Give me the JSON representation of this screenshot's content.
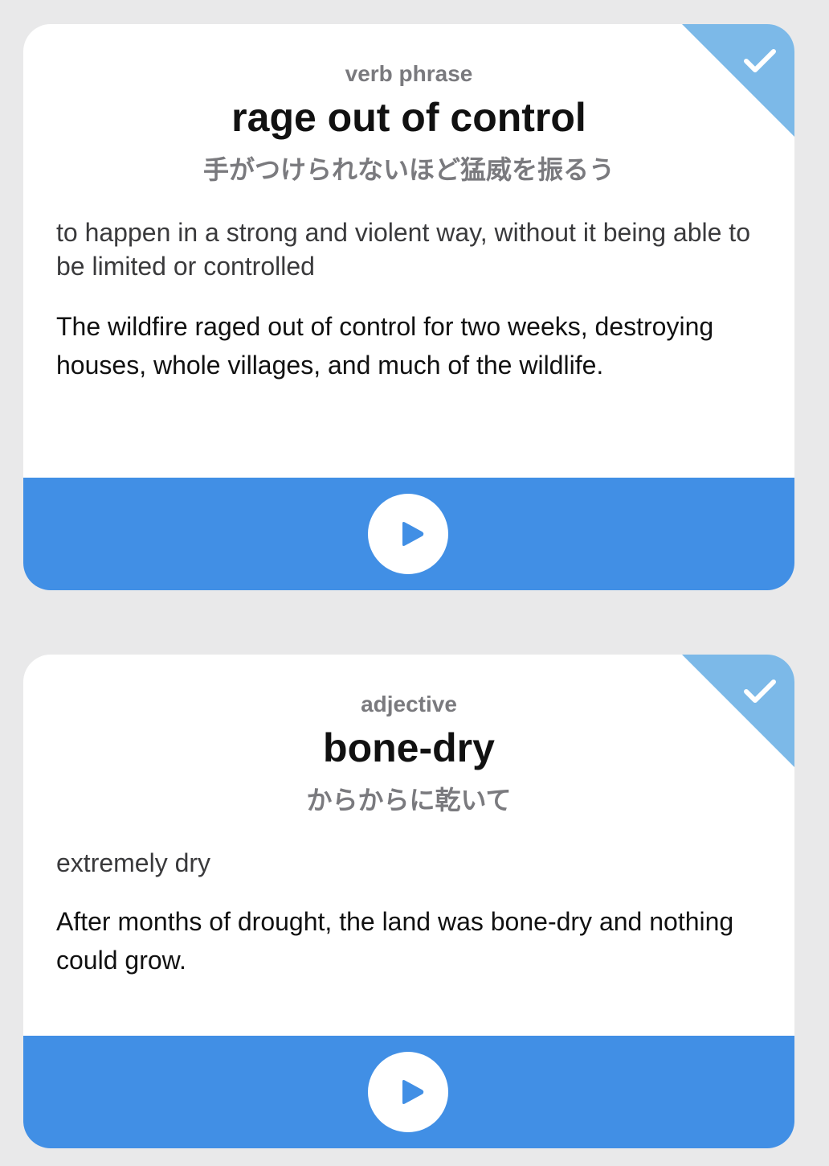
{
  "colors": {
    "background": "#e9e9ea",
    "card": "#ffffff",
    "accent_blue": "#418fe5",
    "corner_badge": "#7cb9e8"
  },
  "cards": [
    {
      "part_of_speech": "verb phrase",
      "word": "rage out of control",
      "translation": "手がつけられないほど猛威を振るう",
      "definition": "to happen in a strong and violent way, without it being able to be limited or controlled",
      "example": "The wildfire raged out of control for two weeks, destroying houses, whole villages, and much of the wildlife.",
      "checked_icon": "checkmark-icon",
      "audio_icon": "play-icon"
    },
    {
      "part_of_speech": "adjective",
      "word": "bone-dry",
      "translation": "からからに乾いて",
      "definition": "extremely dry",
      "example": "After months of drought, the land was bone-dry and nothing could grow.",
      "checked_icon": "checkmark-icon",
      "audio_icon": "play-icon"
    }
  ]
}
